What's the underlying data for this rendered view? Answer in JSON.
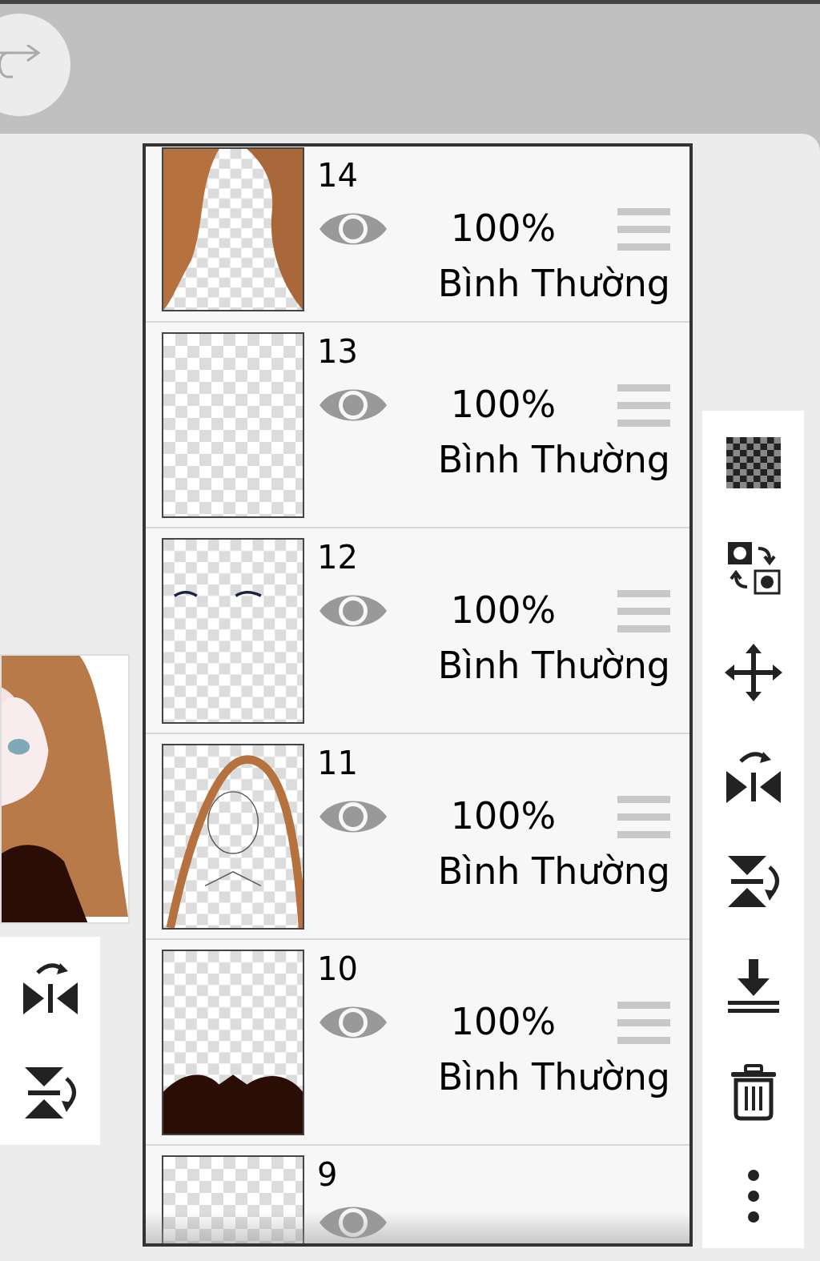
{
  "layers": [
    {
      "number": "14",
      "visible": true,
      "opacity": "100%",
      "blend": "Bình Thường"
    },
    {
      "number": "13",
      "visible": true,
      "opacity": "100%",
      "blend": "Bình Thường"
    },
    {
      "number": "12",
      "visible": true,
      "opacity": "100%",
      "blend": "Bình Thường"
    },
    {
      "number": "11",
      "visible": true,
      "opacity": "100%",
      "blend": "Bình Thường"
    },
    {
      "number": "10",
      "visible": true,
      "opacity": "100%",
      "blend": "Bình Thường"
    },
    {
      "number": "9",
      "visible": true
    }
  ]
}
